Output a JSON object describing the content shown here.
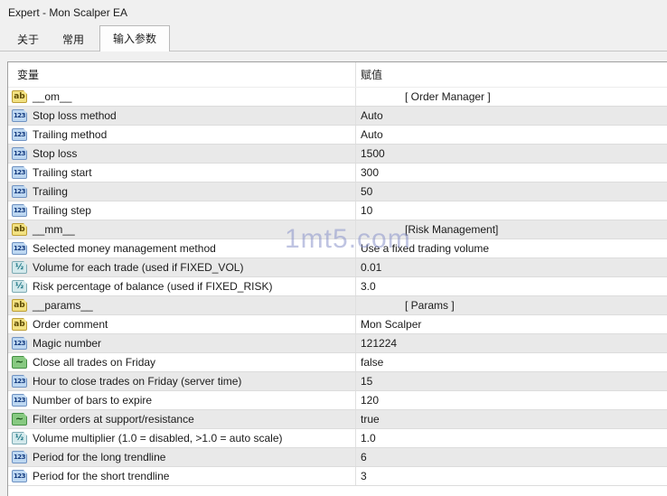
{
  "window": {
    "title": "Expert - Mon Scalper EA"
  },
  "tabs": [
    {
      "key": "about",
      "label": "关于",
      "active": false
    },
    {
      "key": "common",
      "label": "常用",
      "active": false
    },
    {
      "key": "inputs",
      "label": "输入参数",
      "active": true
    }
  ],
  "icons": {
    "string": "ab",
    "integer": "123",
    "double": "½",
    "boolean": "~"
  },
  "colors": {
    "dialog_bg": "#f0f0f0",
    "row_alt_bg": "#e9e9e9",
    "icon_string_bg": "#f2e181",
    "icon_integer_bg": "#bdd7f1",
    "icon_double_bg": "#d3e9ec",
    "icon_boolean_bg": "#87c981",
    "watermark_color": "#8a93cb"
  },
  "watermark": "1mt5.com",
  "table": {
    "columns": [
      "变量",
      "赋值"
    ],
    "rows": [
      {
        "icon": "string",
        "name": "__om__",
        "value": "[ Order Manager ]",
        "section": true
      },
      {
        "icon": "integer",
        "name": "Stop loss method",
        "value": "Auto",
        "section": false
      },
      {
        "icon": "integer",
        "name": "Trailing method",
        "value": "Auto",
        "section": false
      },
      {
        "icon": "integer",
        "name": "Stop loss",
        "value": "1500",
        "section": false
      },
      {
        "icon": "integer",
        "name": "Trailing start",
        "value": "300",
        "section": false
      },
      {
        "icon": "integer",
        "name": "Trailing",
        "value": "50",
        "section": false
      },
      {
        "icon": "integer",
        "name": "Trailing step",
        "value": "10",
        "section": false
      },
      {
        "icon": "string",
        "name": "__mm__",
        "value": "[Risk Management]",
        "section": true
      },
      {
        "icon": "integer",
        "name": "Selected money management method",
        "value": "Use a fixed trading volume",
        "section": false
      },
      {
        "icon": "double",
        "name": "Volume for each trade (used if FIXED_VOL)",
        "value": "0.01",
        "section": false
      },
      {
        "icon": "double",
        "name": "Risk percentage of balance (used if FIXED_RISK)",
        "value": "3.0",
        "section": false
      },
      {
        "icon": "string",
        "name": "__params__",
        "value": "[ Params ]",
        "section": true
      },
      {
        "icon": "string",
        "name": "Order comment",
        "value": "Mon Scalper",
        "section": false
      },
      {
        "icon": "integer",
        "name": "Magic number",
        "value": "121224",
        "section": false
      },
      {
        "icon": "boolean",
        "name": "Close all trades on Friday",
        "value": "false",
        "section": false
      },
      {
        "icon": "integer",
        "name": "Hour to close trades on Friday (server time)",
        "value": "15",
        "section": false
      },
      {
        "icon": "integer",
        "name": "Number of bars to expire",
        "value": "120",
        "section": false
      },
      {
        "icon": "boolean",
        "name": "Filter orders at support/resistance",
        "value": "true",
        "section": false
      },
      {
        "icon": "double",
        "name": "Volume multiplier (1.0 = disabled, >1.0 = auto scale)",
        "value": "1.0",
        "section": false
      },
      {
        "icon": "integer",
        "name": "Period for the long trendline",
        "value": "6",
        "section": false
      },
      {
        "icon": "integer",
        "name": "Period for the short trendline",
        "value": "3",
        "section": false
      }
    ]
  }
}
